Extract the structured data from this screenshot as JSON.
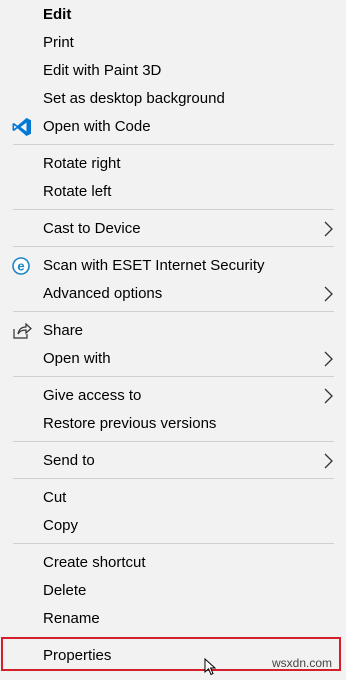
{
  "menu": {
    "items": [
      {
        "label": "Edit"
      },
      {
        "label": "Print"
      },
      {
        "label": "Edit with Paint 3D"
      },
      {
        "label": "Set as desktop background"
      },
      {
        "label": "Open with Code",
        "icon": "vscode-icon"
      },
      {
        "label": "Rotate right"
      },
      {
        "label": "Rotate left"
      },
      {
        "label": "Cast to Device",
        "submenu": true
      },
      {
        "label": "Scan with ESET Internet Security",
        "icon": "eset-icon"
      },
      {
        "label": "Advanced options",
        "submenu": true
      },
      {
        "label": "Share",
        "icon": "share-icon"
      },
      {
        "label": "Open with",
        "submenu": true
      },
      {
        "label": "Give access to",
        "submenu": true
      },
      {
        "label": "Restore previous versions"
      },
      {
        "label": "Send to",
        "submenu": true
      },
      {
        "label": "Cut"
      },
      {
        "label": "Copy"
      },
      {
        "label": "Create shortcut"
      },
      {
        "label": "Delete"
      },
      {
        "label": "Rename"
      },
      {
        "label": "Properties"
      }
    ]
  },
  "watermark": "wsxdn.com",
  "colors": {
    "menu_background": "#f2f2f2",
    "separator": "#d0d0d0",
    "highlight_border": "#d3202a",
    "vscode_blue": "#0078d4",
    "eset_blue": "#1a86c8"
  }
}
